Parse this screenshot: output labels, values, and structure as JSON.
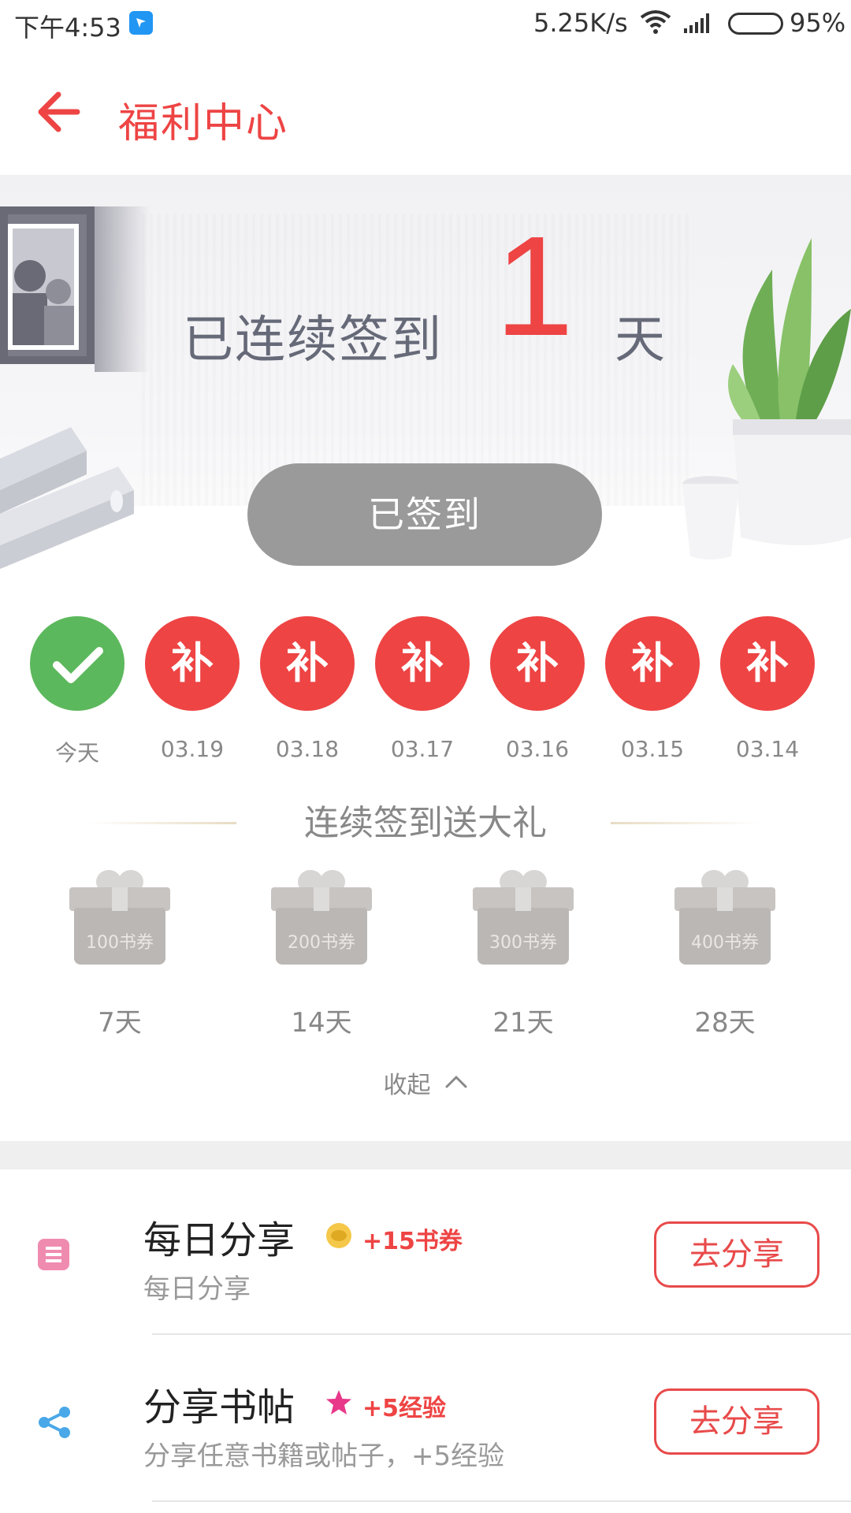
{
  "status_bar": {
    "time": "下午4:53",
    "network_speed": "5.25K/s",
    "battery": "95%",
    "icons": [
      "app-notification-icon",
      "wifi-icon",
      "signal-icon",
      "battery-icon"
    ]
  },
  "app_bar": {
    "title": "福利中心",
    "back_icon": "arrow-left-icon"
  },
  "hero": {
    "streak_label": "已连续签到",
    "streak_days": "1",
    "streak_unit": "天",
    "signed_button_label": "已签到"
  },
  "days": [
    {
      "mark": "",
      "label": "今天",
      "status": "signed"
    },
    {
      "mark": "补",
      "label": "03.19",
      "status": "makeup"
    },
    {
      "mark": "补",
      "label": "03.18",
      "status": "makeup"
    },
    {
      "mark": "补",
      "label": "03.17",
      "status": "makeup"
    },
    {
      "mark": "补",
      "label": "03.16",
      "status": "makeup"
    },
    {
      "mark": "补",
      "label": "03.15",
      "status": "makeup"
    },
    {
      "mark": "补",
      "label": "03.14",
      "status": "makeup"
    }
  ],
  "gifts": {
    "title": "连续签到送大礼",
    "items": [
      {
        "amount": "100书券",
        "days": "7天"
      },
      {
        "amount": "200书券",
        "days": "14天"
      },
      {
        "amount": "300书券",
        "days": "21天"
      },
      {
        "amount": "400书券",
        "days": "28天"
      }
    ],
    "collapse_label": "收起"
  },
  "tasks": [
    {
      "name": "每日分享",
      "reward": "+15书券",
      "reward_icon": "coin-icon",
      "desc": "每日分享",
      "button": "去分享",
      "icon": "daily-share-icon"
    },
    {
      "name": "分享书帖",
      "reward": "+5经验",
      "reward_icon": "star-icon",
      "desc": "分享任意书籍或帖子，+5经验",
      "button": "去分享",
      "icon": "share-icon"
    }
  ],
  "colors": {
    "accent": "#ee4444",
    "success": "#5cb85c",
    "disabled_button": "#9a9a9a",
    "gift_gray": "#bbb7b5"
  }
}
